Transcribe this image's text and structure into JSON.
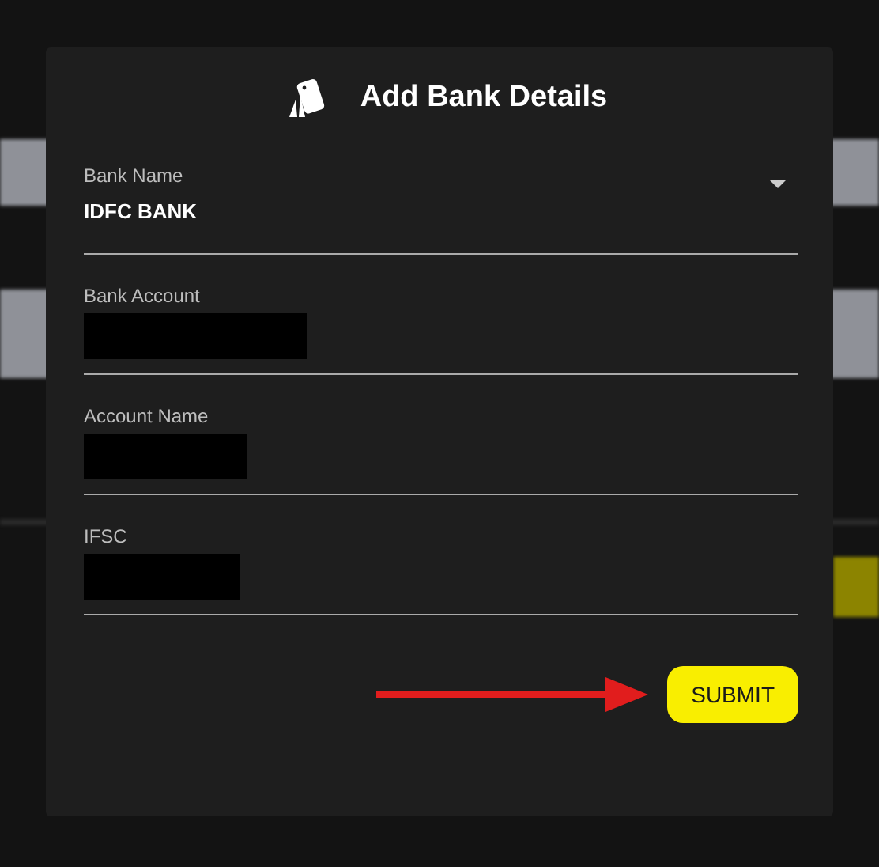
{
  "dialog": {
    "title": "Add Bank Details",
    "fields": [
      {
        "kind": "select",
        "label": "Bank Name",
        "value": "IDFC BANK",
        "redacted": false
      },
      {
        "kind": "text",
        "label": "Bank Account",
        "redacted": true
      },
      {
        "kind": "text",
        "label": "Account Name",
        "redacted": true
      },
      {
        "kind": "text",
        "label": "IFSC",
        "redacted": true
      }
    ],
    "submit_button": "SUBMIT",
    "pointer_arrow": true
  }
}
